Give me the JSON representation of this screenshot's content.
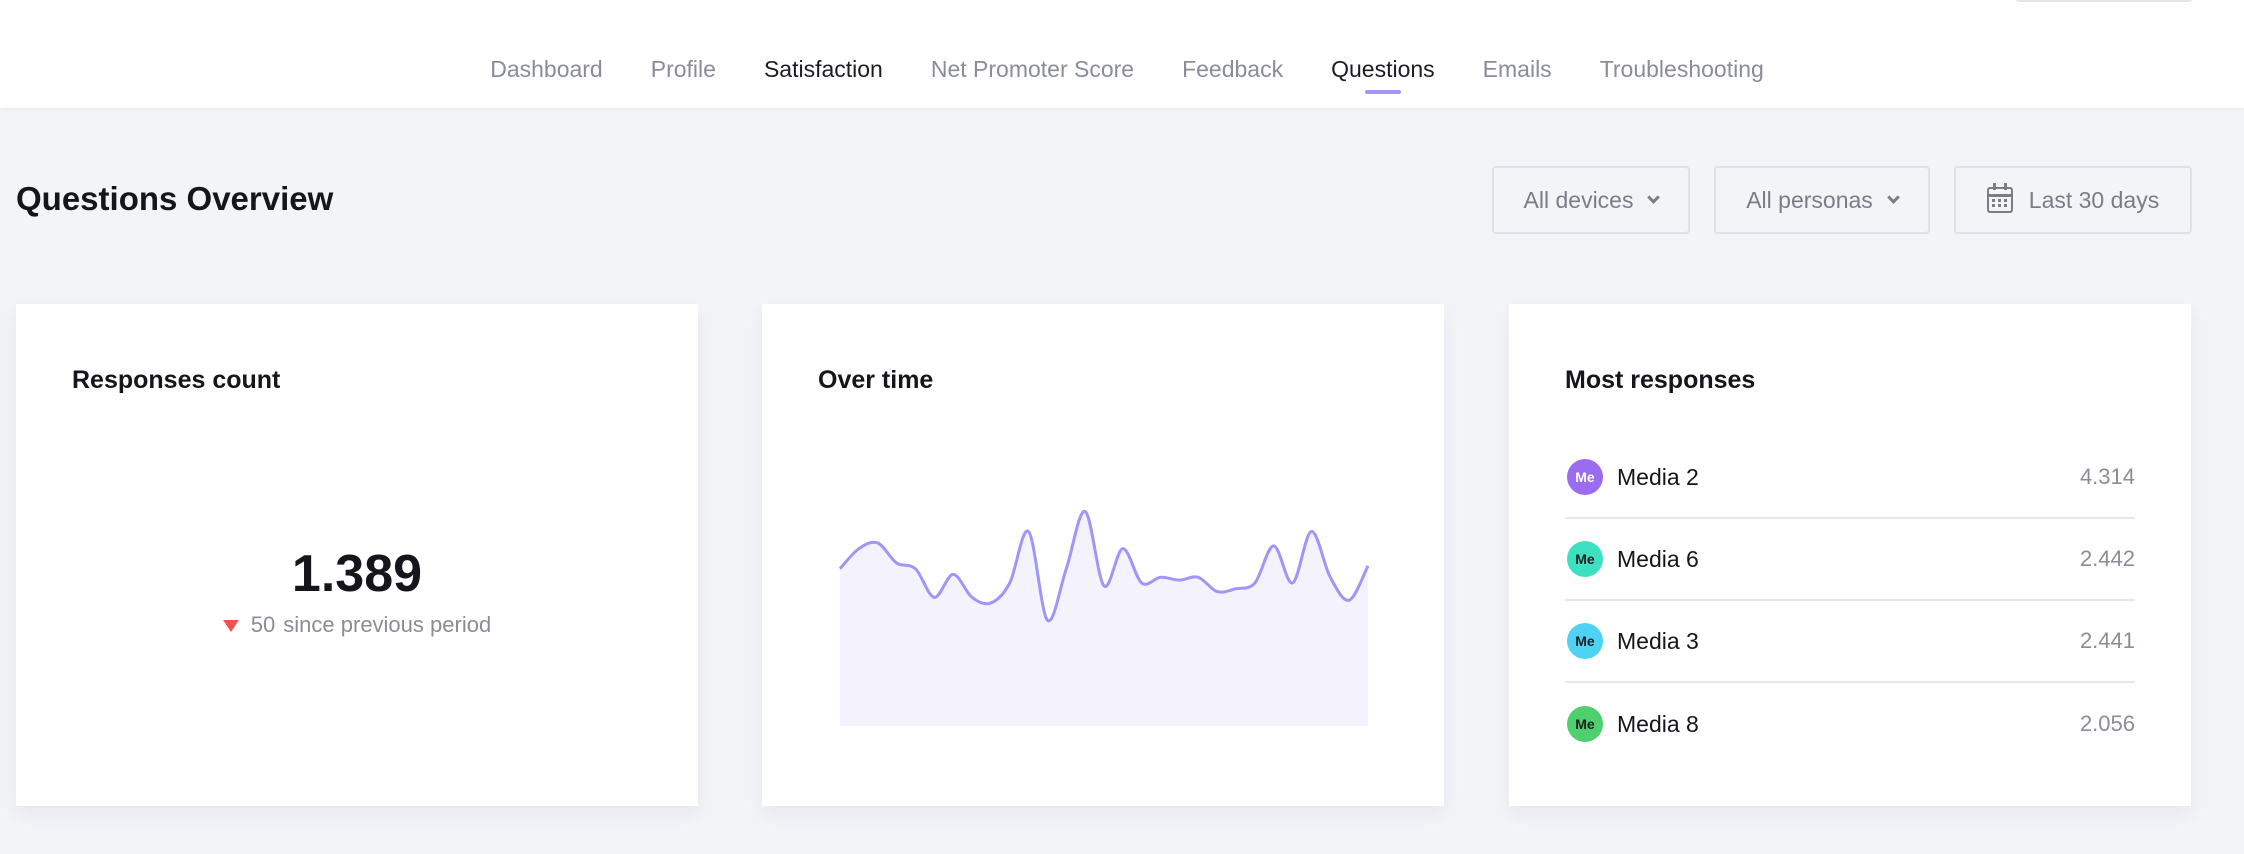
{
  "nav": {
    "tabs": [
      {
        "label": "Dashboard"
      },
      {
        "label": "Profile"
      },
      {
        "label": "Satisfaction"
      },
      {
        "label": "Net Promoter Score"
      },
      {
        "label": "Feedback"
      },
      {
        "label": "Questions"
      },
      {
        "label": "Emails"
      },
      {
        "label": "Troubleshooting"
      }
    ],
    "active_tab": "Questions"
  },
  "header": {
    "title": "Questions Overview",
    "filters": {
      "devices": "All devices",
      "personas": "All personas",
      "date_range": "Last 30 days"
    }
  },
  "cards": {
    "responses_count": {
      "title": "Responses count",
      "value": "1.389",
      "delta_value": "50",
      "delta_text": "since previous period",
      "delta_direction": "down"
    },
    "over_time": {
      "title": "Over time"
    },
    "most_responses": {
      "title": "Most responses",
      "items": [
        {
          "avatar": "Me",
          "label": "Media 2",
          "value": "4.314",
          "color": "#9b6cf0"
        },
        {
          "avatar": "Me",
          "label": "Media 6",
          "value": "2.442",
          "color": "#3ee0c2"
        },
        {
          "avatar": "Me",
          "label": "Media 3",
          "value": "2.441",
          "color": "#4fd3f5"
        },
        {
          "avatar": "Me",
          "label": "Media 8",
          "value": "2.056",
          "color": "#4fcf6e"
        }
      ]
    }
  },
  "colors": {
    "accent": "#9f96f5",
    "area_fill": "#f3f2fd",
    "negative": "#f0524f"
  },
  "chart_data": {
    "type": "area",
    "title": "Over time",
    "xlabel": "",
    "ylabel": "",
    "grid": false,
    "ylim": [
      0,
      100
    ],
    "series": [
      {
        "values": [
          55,
          62,
          64,
          57,
          55,
          45,
          53,
          45,
          43,
          50,
          68,
          37,
          55,
          75,
          49,
          62,
          50,
          52,
          51,
          52,
          47,
          48,
          50,
          63,
          50,
          68,
          52,
          44,
          56
        ]
      }
    ]
  }
}
